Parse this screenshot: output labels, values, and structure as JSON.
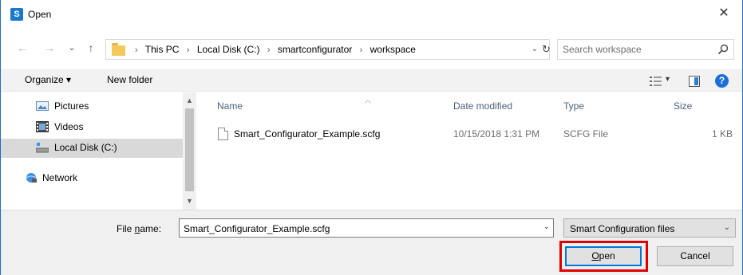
{
  "window": {
    "title": "Open",
    "app_icon_glyph": "S",
    "close_glyph": "✕"
  },
  "nav": {
    "back_glyph": "←",
    "forward_glyph": "→",
    "recent_glyph": "⌄",
    "up_glyph": "↑"
  },
  "address": {
    "crumbs": [
      "This PC",
      "Local Disk (C:)",
      "smartconfigurator",
      "workspace"
    ],
    "separator": "›",
    "dropdown_glyph": "⌄",
    "refresh_glyph": "↻"
  },
  "search": {
    "placeholder": "Search workspace"
  },
  "toolbar": {
    "organize_label": "Organize ▾",
    "new_folder_label": "New folder",
    "view_glyph": "▾",
    "help_glyph": "?"
  },
  "sidebar": {
    "items": [
      {
        "label": "Pictures",
        "icon": "pictures-icon"
      },
      {
        "label": "Videos",
        "icon": "videos-icon"
      },
      {
        "label": "Local Disk (C:)",
        "icon": "local-disk-icon",
        "selected": true
      },
      {
        "label": "Network",
        "icon": "network-icon"
      }
    ],
    "scroll_up_glyph": "▲",
    "scroll_down_glyph": "▼"
  },
  "filelist": {
    "columns": [
      "Name",
      "Date modified",
      "Type",
      "Size"
    ],
    "sort_glyph": "︿",
    "rows": [
      {
        "name": "Smart_Configurator_Example.scfg",
        "date": "10/15/2018 1:31 PM",
        "type": "SCFG File",
        "size": "1 KB"
      }
    ]
  },
  "bottom": {
    "file_name_label_prefix": "File ",
    "file_name_label_accel": "n",
    "file_name_label_suffix": "ame:",
    "file_name_value": "Smart_Configurator_Example.scfg",
    "file_name_dropdown_glyph": "⌄",
    "filter_value": "Smart Configuration files",
    "filter_dropdown_glyph": "⌄",
    "open_accel": "O",
    "open_rest": "pen",
    "cancel_label": "Cancel"
  },
  "colors": {
    "accent": "#0078d7",
    "highlight": "#e00000",
    "selected_bg": "#d9d9d9"
  }
}
